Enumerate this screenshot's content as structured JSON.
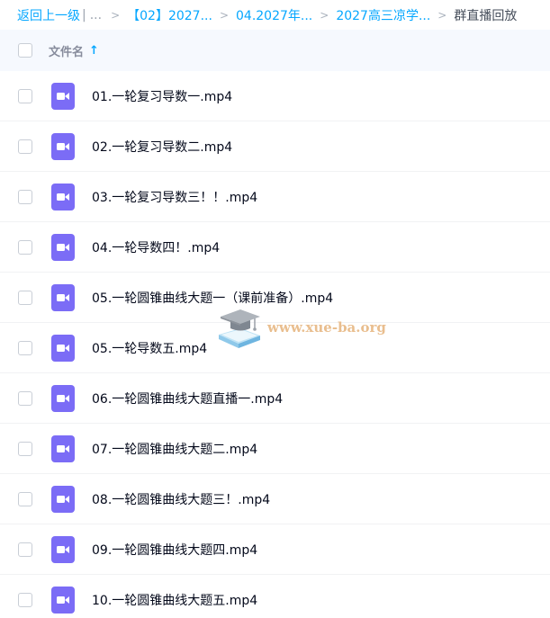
{
  "breadcrumb": {
    "back_label": "返回上一级",
    "divider": "|",
    "ellipsis": "...",
    "separator": ">",
    "items": [
      "【02】2027...",
      "04.2027年...",
      "2027高三凉学..."
    ],
    "current": "群直播回放"
  },
  "table_header": {
    "filename_label": "文件名",
    "sort_icon": "arrow-up-icon",
    "sort_glyph": "↑"
  },
  "files": [
    {
      "name": "01.一轮复习导数一.mp4",
      "icon": "video-icon"
    },
    {
      "name": "02.一轮复习导数二.mp4",
      "icon": "video-icon"
    },
    {
      "name": "03.一轮复习导数三！！.mp4",
      "icon": "video-icon"
    },
    {
      "name": "04.一轮导数四！.mp4",
      "icon": "video-icon"
    },
    {
      "name": "05.一轮圆锥曲线大题一（课前准备）.mp4",
      "icon": "video-icon"
    },
    {
      "name": "05.一轮导数五.mp4",
      "icon": "video-icon"
    },
    {
      "name": "06.一轮圆锥曲线大题直播一.mp4",
      "icon": "video-icon"
    },
    {
      "name": "07.一轮圆锥曲线大题二.mp4",
      "icon": "video-icon"
    },
    {
      "name": "08.一轮圆锥曲线大题三！.mp4",
      "icon": "video-icon"
    },
    {
      "name": "09.一轮圆锥曲线大题四.mp4",
      "icon": "video-icon"
    },
    {
      "name": "10.一轮圆锥曲线大题五.mp4",
      "icon": "video-icon"
    }
  ],
  "watermark": {
    "text": "www.xue-ba.org",
    "icon": "graduation-cap-icon"
  },
  "colors": {
    "accent": "#06a7ff",
    "video_icon": "#7b6cf6",
    "header_bg": "#f6f9fe",
    "watermark": "#e7b883"
  }
}
